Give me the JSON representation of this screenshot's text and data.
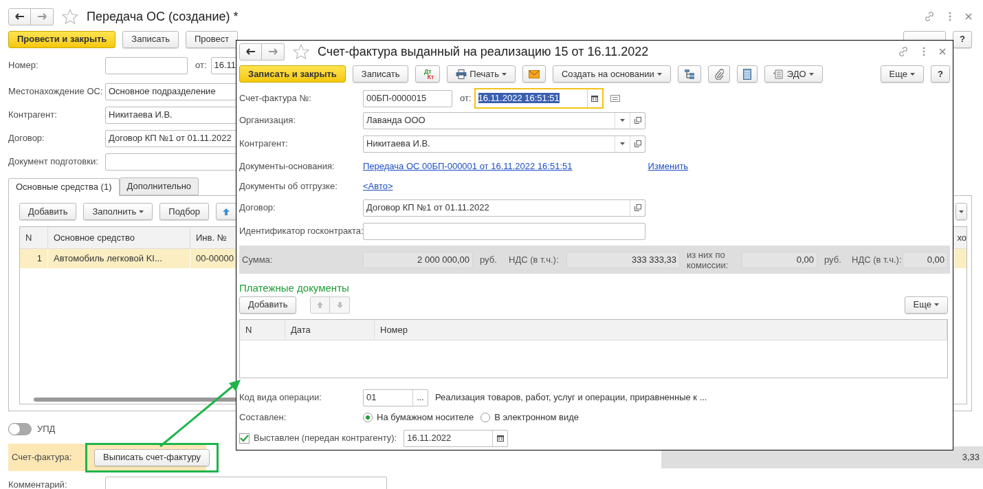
{
  "main_window": {
    "title": "Передача ОС (создание) *",
    "toolbar": [
      {
        "kind": "primary",
        "label": "Провести и закрыть"
      },
      {
        "kind": "normal",
        "label": "Записать"
      },
      {
        "kind": "normal",
        "label": "Провест"
      }
    ],
    "number": {
      "label": "Номер:",
      "date_label": "от:",
      "date": "16.11"
    },
    "fields": [
      {
        "label": "Местонахождение ОС:",
        "value": "Основное подразделение"
      },
      {
        "label": "Контрагент:",
        "value": "Никитаева И.В."
      },
      {
        "label": "Договор:",
        "value": "Договор КП №1 от 01.11.2022"
      },
      {
        "label": "Документ подготовки:"
      }
    ],
    "tabs": [
      {
        "label": "Основные средства (1)",
        "selected": true
      },
      {
        "label": "Дополнительно",
        "selected": false
      }
    ],
    "table_toolbar": [
      {
        "kind": "normal",
        "label": "Добавить"
      },
      {
        "kind": "menu",
        "label": "Заполнить"
      },
      {
        "kind": "normal",
        "label": "Подбор"
      },
      {
        "kind": "up"
      }
    ],
    "table": {
      "columns": [
        "N",
        "Основное средство",
        "Инв. №",
        "хо"
      ],
      "rows": [
        {
          "cells": [
            "1",
            "Автомобиль легковой KI...",
            "00-00000"
          ],
          "selected": true
        }
      ]
    },
    "upd": {
      "label": "УПД",
      "on": false
    },
    "invoice": {
      "label": "Счет-фактура:",
      "button": "Выписать счет-фактуру"
    },
    "total_fragment": "3,33",
    "comment": {
      "label": "Комментарий:"
    }
  },
  "invoice_dialog": {
    "title": "Счет-фактура выданный на реализацию 15 от 16.11.2022",
    "toolbar": [
      {
        "kind": "primary",
        "label": "Записать и закрыть"
      },
      {
        "kind": "normal",
        "label": "Записать"
      },
      {
        "kind": "dtkt",
        "label": "Дт",
        "label2": "Кт"
      },
      {
        "kind": "print",
        "label": "Печать"
      },
      {
        "kind": "mail"
      },
      {
        "kind": "menu",
        "label": "Создать на основании"
      },
      {
        "kind": "structure"
      },
      {
        "kind": "clip"
      },
      {
        "kind": "list"
      },
      {
        "kind": "edo",
        "label": "ЭДО"
      }
    ],
    "more": "Еще",
    "help": "?",
    "number": {
      "label": "Счет-фактура №:",
      "value": "00БП-0000015",
      "date_label": "от:",
      "date": "16.11.2022 16:51:51"
    },
    "organization": {
      "label": "Организация:",
      "value": "Лаванда ООО"
    },
    "counterparty": {
      "label": "Контрагент:",
      "value": "Никитаева И.В."
    },
    "base_documents": {
      "label": "Документы-основания:",
      "link": "Передача ОС 00БП-000001 от 16.11.2022 16:51:51",
      "change": "Изменить"
    },
    "shipment_documents": {
      "label": "Документы об отгрузке:",
      "link": "<Авто>"
    },
    "contract": {
      "label": "Договор:",
      "value": "Договор КП №1 от 01.11.2022"
    },
    "gov_contract": {
      "label": "Идентификатор госконтракта:"
    },
    "totals": {
      "label": "Сумма:",
      "amount": "2 000 000,00",
      "currency": "руб.",
      "vat_label": "НДС (в т.ч.):",
      "vat": "333 333,33",
      "commission_label": "из них по комиссии:",
      "commission": "0,00",
      "commission_currency": "руб.",
      "commission_vat_label": "НДС (в т.ч.):",
      "commission_vat": "0,00"
    },
    "payments": {
      "title": "Платежные документы",
      "add": "Добавить",
      "more": "Еще",
      "columns": [
        "N",
        "Дата",
        "Номер"
      ]
    },
    "operation": {
      "label": "Код вида операции:",
      "code": "01",
      "button": "...",
      "description": "Реализация товаров, работ, услуг и операции, приравненные к ..."
    },
    "composed": {
      "label": "Составлен:",
      "options": [
        {
          "label": "На бумажном носителе",
          "selected": true
        },
        {
          "label": "В электронном виде",
          "selected": false
        }
      ]
    },
    "issued": {
      "label": "Выставлен (передан контрагенту):",
      "checked": true,
      "date": "16.11.2022"
    }
  }
}
